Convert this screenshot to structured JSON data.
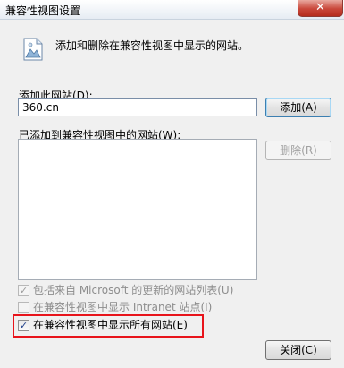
{
  "window": {
    "title": "兼容性视图设置",
    "close_glyph": "✕"
  },
  "info": {
    "icon": "document-image-icon",
    "text": "添加和删除在兼容性视图中显示的网站。"
  },
  "add_site": {
    "label": "添加此网站(D):",
    "value": "360.cn",
    "button_label": "添加(A)"
  },
  "site_list": {
    "label": "已添加到兼容性视图中的网站(W):",
    "items": [],
    "remove_label": "删除(R)"
  },
  "options": [
    {
      "label": "包括来自 Microsoft 的更新的网站列表(U)",
      "checked": true,
      "enabled": false
    },
    {
      "label": "在兼容性视图中显示 Intranet 站点(I)",
      "checked": false,
      "enabled": false
    },
    {
      "label": "在兼容性视图中显示所有网站(E)",
      "checked": true,
      "enabled": true
    }
  ],
  "footer": {
    "close_label": "关闭(C)"
  },
  "colors": {
    "highlight": "#e8141b"
  }
}
